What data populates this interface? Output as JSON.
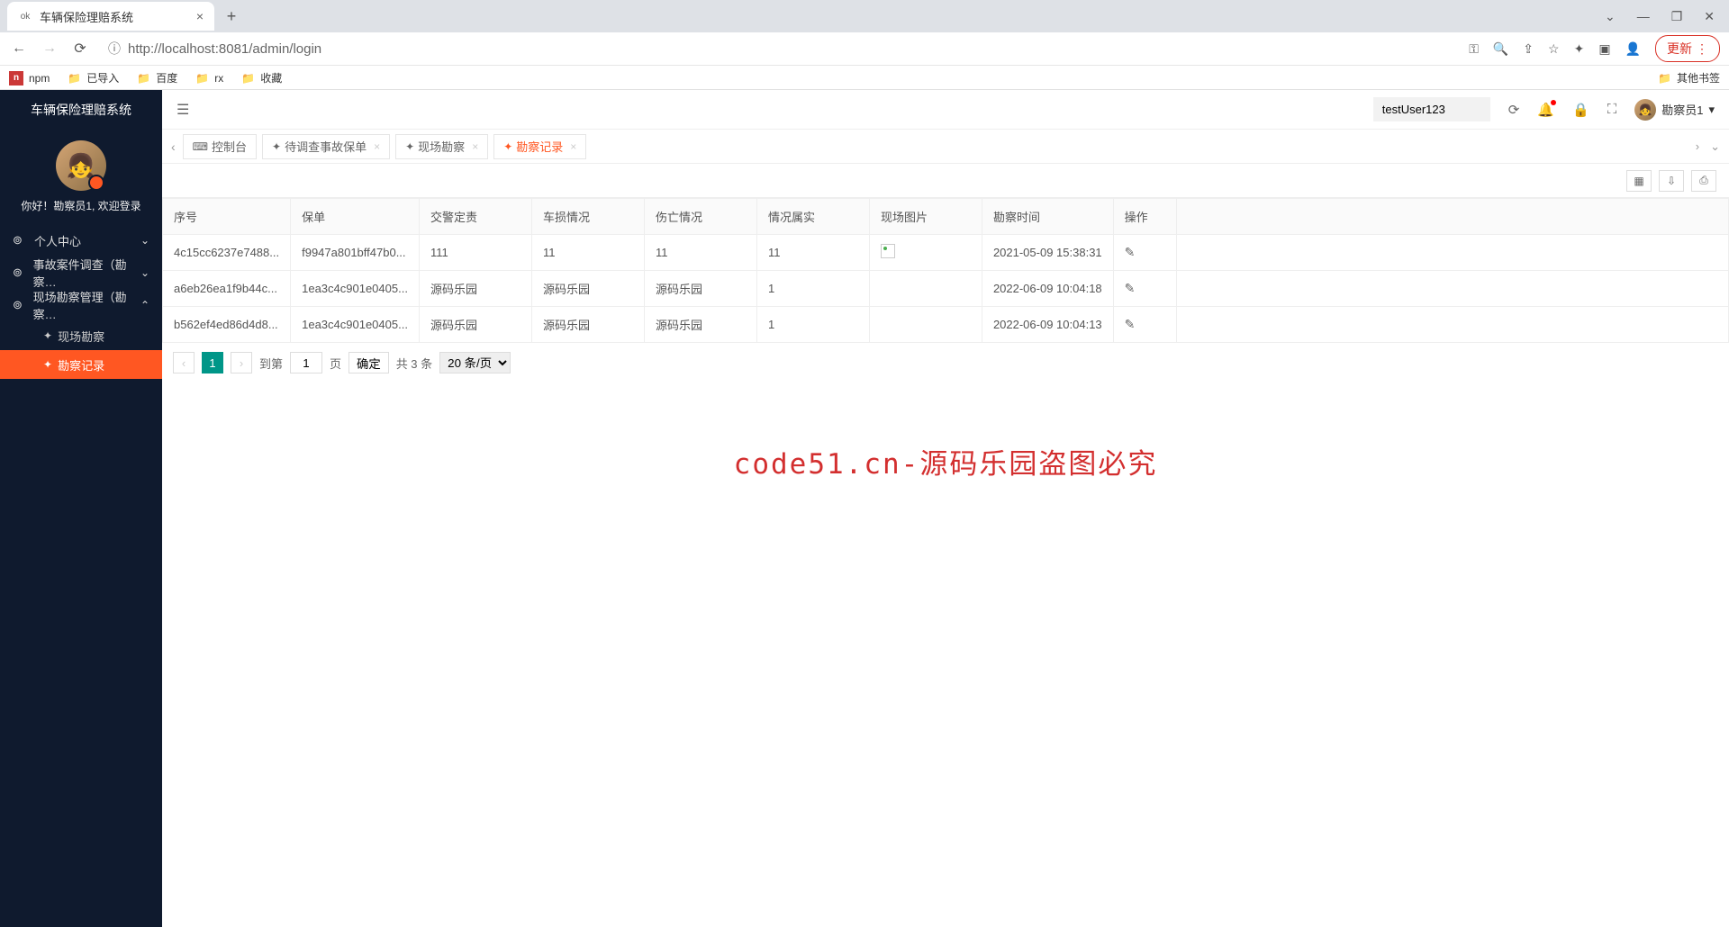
{
  "browser": {
    "tab_title": "车辆保险理赔系统",
    "url": "http://localhost:8081/admin/login",
    "update_label": "更新",
    "bookmarks": [
      "npm",
      "已导入",
      "百度",
      "rx",
      "收藏"
    ],
    "other_bookmarks": "其他书签"
  },
  "sidebar": {
    "title": "车辆保险理赔系统",
    "welcome": "你好！勘察员1, 欢迎登录",
    "menu": [
      {
        "label": "个人中心",
        "expanded": false
      },
      {
        "label": "事故案件调查（勘察…",
        "expanded": false
      },
      {
        "label": "现场勘察管理（勘察…",
        "expanded": true
      }
    ],
    "submenu": [
      {
        "label": "现场勘察",
        "active": false
      },
      {
        "label": "勘察记录",
        "active": true
      }
    ]
  },
  "topbar": {
    "user_input_value": "testUser123",
    "username": "勘察员1"
  },
  "tabs": [
    {
      "label": "控制台",
      "icon": "console",
      "closable": false,
      "active": false
    },
    {
      "label": "待调查事故保单",
      "icon": "hand",
      "closable": true,
      "active": false
    },
    {
      "label": "现场勘察",
      "icon": "hand",
      "closable": true,
      "active": false
    },
    {
      "label": "勘察记录",
      "icon": "hand",
      "closable": true,
      "active": true
    }
  ],
  "table": {
    "headers": [
      "序号",
      "保单",
      "交警定责",
      "车损情况",
      "伤亡情况",
      "情况属实",
      "现场图片",
      "勘察时间",
      "操作"
    ],
    "rows": [
      {
        "seq": "4c15cc6237e7488...",
        "order": "f9947a801bff47b0...",
        "resp": "111",
        "damage": "11",
        "injury": "11",
        "truth": "11",
        "img_type": "broken",
        "time": "2021-05-09 15:38:31"
      },
      {
        "seq": "a6eb26ea1f9b44c...",
        "order": "1ea3c4c901e0405...",
        "resp": "源码乐园",
        "damage": "源码乐园",
        "injury": "源码乐园",
        "truth": "1",
        "img_type": "thumb",
        "time": "2022-06-09 10:04:18"
      },
      {
        "seq": "b562ef4ed86d4d8...",
        "order": "1ea3c4c901e0405...",
        "resp": "源码乐园",
        "damage": "源码乐园",
        "injury": "源码乐园",
        "truth": "1",
        "img_type": "thumb",
        "time": "2022-06-09 10:04:13"
      }
    ]
  },
  "pagination": {
    "current": "1",
    "goto_label": "到第",
    "page_input": "1",
    "page_unit": "页",
    "confirm": "确定",
    "total": "共 3 条",
    "per_page": "20 条/页"
  },
  "watermark": "code51.cn-源码乐园盗图必究"
}
